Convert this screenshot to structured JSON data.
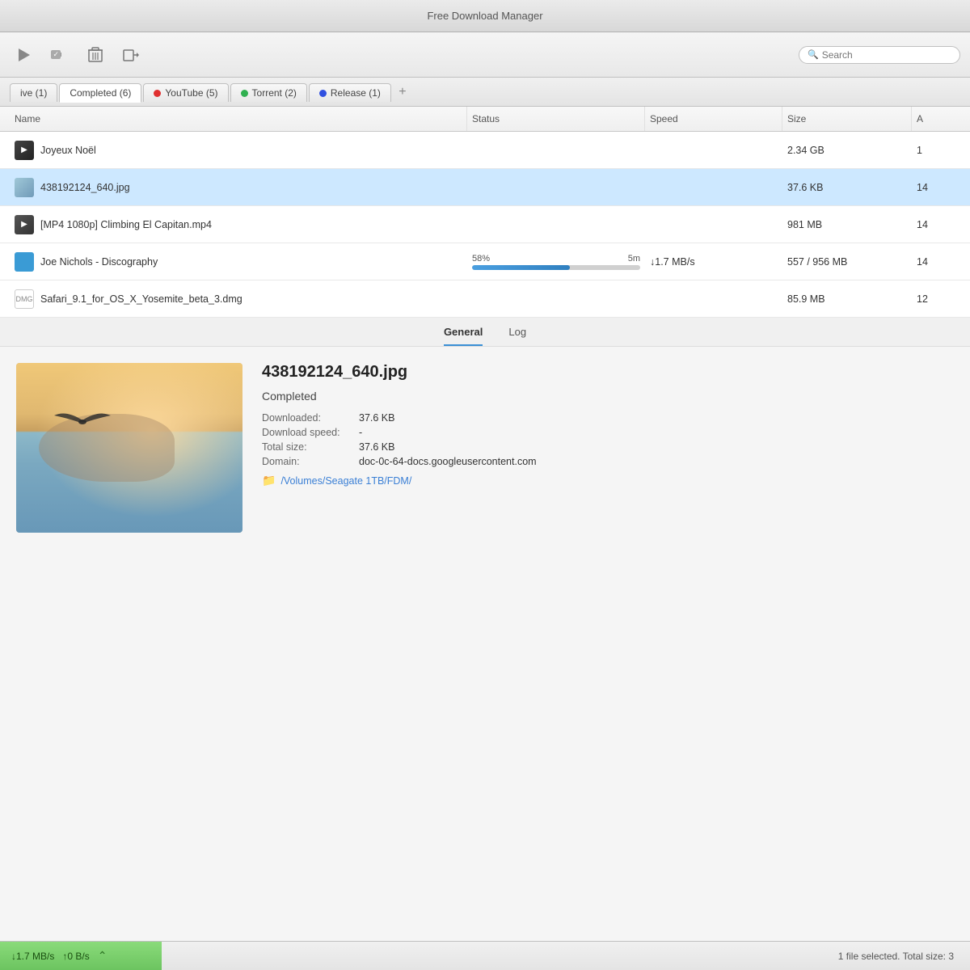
{
  "window": {
    "title": "Free Download Manager"
  },
  "toolbar": {
    "play_label": "▶",
    "pause_label": "⏸",
    "delete_label": "🗑",
    "move_label": "➡",
    "search_placeholder": "Search"
  },
  "tabs": [
    {
      "id": "active",
      "label": "ive (1)",
      "color": null,
      "active": false
    },
    {
      "id": "completed",
      "label": "Completed (6)",
      "color": null,
      "active": true
    },
    {
      "id": "youtube",
      "label": "YouTube (5)",
      "color": "#e03030",
      "active": false
    },
    {
      "id": "torrent",
      "label": "Torrent (2)",
      "color": "#30b050",
      "active": false
    },
    {
      "id": "release",
      "label": "Release (1)",
      "color": "#3050e0",
      "active": false
    }
  ],
  "table": {
    "headers": [
      "Name",
      "Status",
      "Speed",
      "Size",
      "A"
    ],
    "rows": [
      {
        "id": "row1",
        "name": "Joyeux Noël",
        "status": "",
        "speed": "",
        "size": "2.34 GB",
        "added": "1",
        "icon_type": "video",
        "selected": false
      },
      {
        "id": "row2",
        "name": "438192124_640.jpg",
        "status": "",
        "speed": "",
        "size": "37.6 KB",
        "added": "14",
        "icon_type": "image",
        "selected": true
      },
      {
        "id": "row3",
        "name": "[MP4 1080p] Climbing El Capitan.mp4",
        "status": "",
        "speed": "",
        "size": "981 MB",
        "added": "14",
        "icon_type": "video",
        "selected": false
      },
      {
        "id": "row4",
        "name": "Joe Nichols - Discography",
        "status_percent": "58%",
        "status_time": "5m",
        "speed": "↓1.7 MB/s",
        "size": "557 / 956 MB",
        "added": "14",
        "icon_type": "torrent",
        "selected": false,
        "progress": 58
      },
      {
        "id": "row5",
        "name": "Safari_9.1_for_OS_X_Yosemite_beta_3.dmg",
        "status": "",
        "speed": "",
        "size": "85.9 MB",
        "added": "12",
        "icon_type": "dmg",
        "selected": false
      }
    ]
  },
  "detail_panel": {
    "tabs": [
      "General",
      "Log"
    ],
    "active_tab": "General",
    "filename": "438192124_640.jpg",
    "status": "Completed",
    "downloaded_label": "Downloaded:",
    "downloaded_value": "37.6 KB",
    "download_speed_label": "Download speed:",
    "download_speed_value": "-",
    "total_size_label": "Total size:",
    "total_size_value": "37.6 KB",
    "domain_label": "Domain:",
    "domain_value": "doc-0c-64-docs.googleusercontent.com",
    "path": "/Volumes/Seagate 1TB/FDM/"
  },
  "status_bar": {
    "download_speed": "1.7 MB/s",
    "download_prefix": "↓",
    "upload_speed": "0 B/s",
    "upload_prefix": "↑",
    "selection_info": "1 file selected. Total size: 3"
  }
}
